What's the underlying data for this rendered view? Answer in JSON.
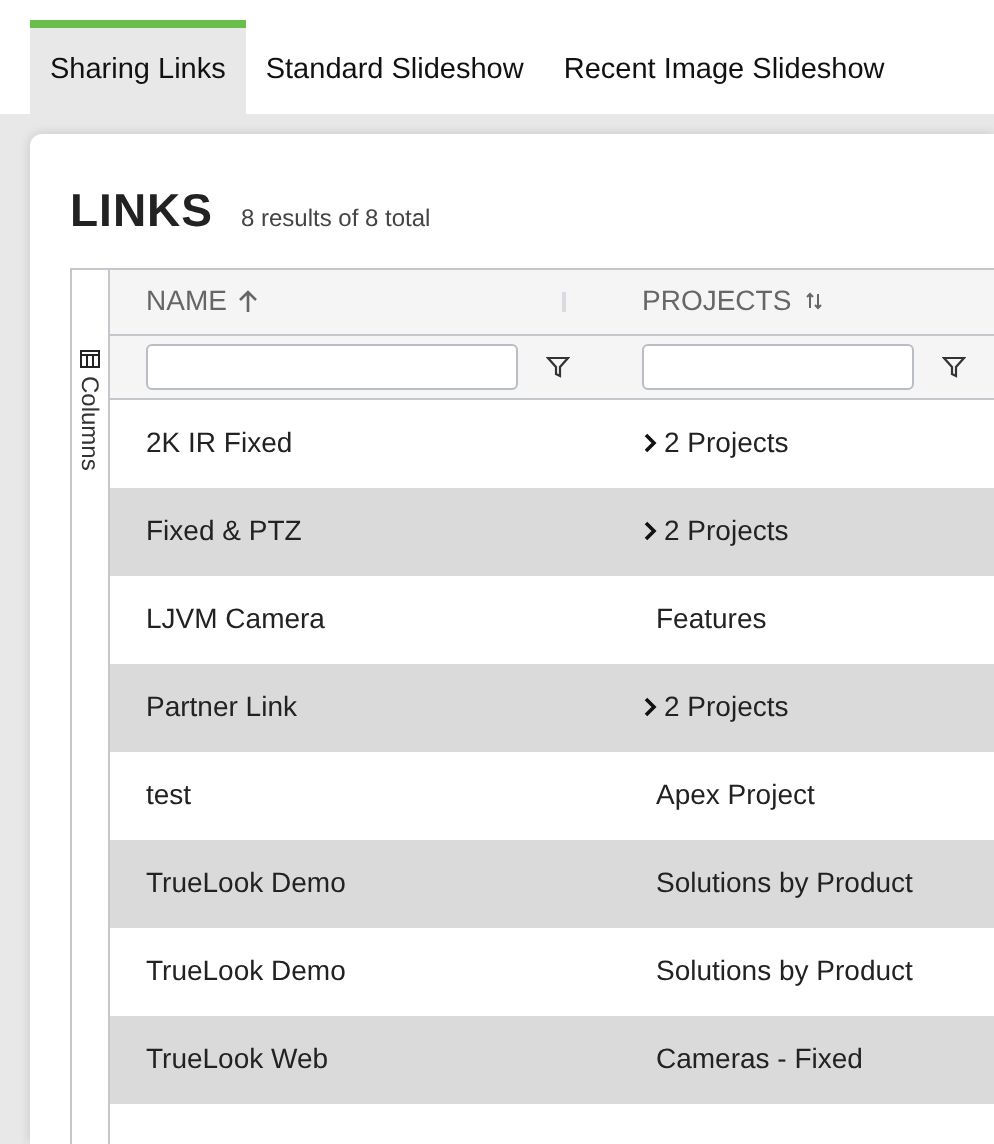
{
  "tabs": [
    {
      "label": "Sharing Links",
      "selected": true
    },
    {
      "label": "Standard Slideshow",
      "selected": false
    },
    {
      "label": "Recent Image Slideshow",
      "selected": false
    }
  ],
  "title": "LINKS",
  "result_count": "8 results of 8 total",
  "side_panel": {
    "label": "Columns"
  },
  "table": {
    "columns": [
      {
        "label": "NAME",
        "sorted": true
      },
      {
        "label": "PROJECTS",
        "sorted": false
      }
    ],
    "rows": [
      {
        "name": "2K IR Fixed",
        "projects": "2 Projects",
        "kind": "expandable"
      },
      {
        "name": "Fixed & PTZ",
        "projects": "2 Projects",
        "kind": "expandable"
      },
      {
        "name": "LJVM Camera",
        "projects": "Features",
        "kind": "plain"
      },
      {
        "name": "Partner Link",
        "projects": "2 Projects",
        "kind": "expandable"
      },
      {
        "name": "test",
        "projects": "Apex Project",
        "kind": "plain"
      },
      {
        "name": "TrueLook Demo",
        "projects": "Solutions by Product",
        "kind": "plain"
      },
      {
        "name": "TrueLook Demo",
        "projects": "Solutions by Product",
        "kind": "plain"
      },
      {
        "name": "TrueLook Web",
        "projects": "Cameras - Fixed",
        "kind": "plain"
      }
    ]
  }
}
